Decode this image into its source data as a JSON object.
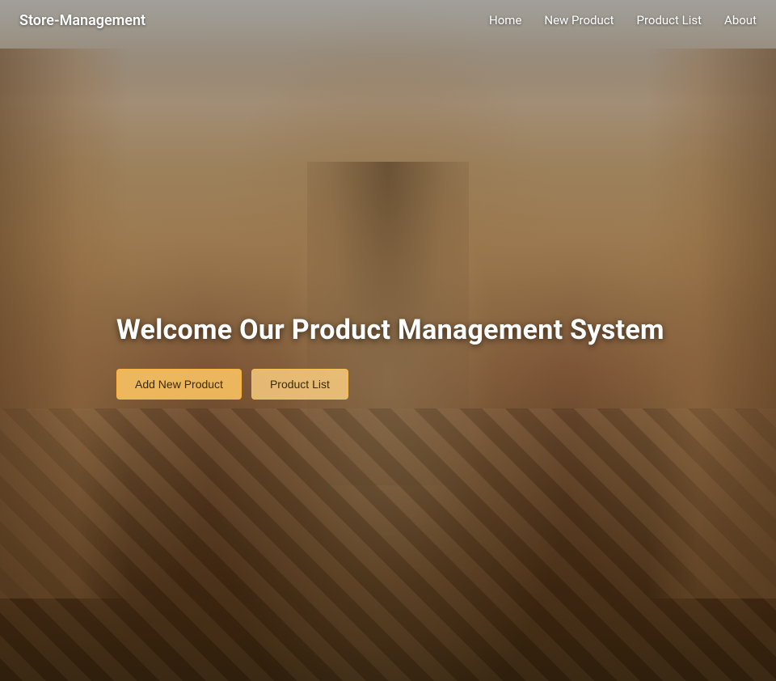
{
  "brand": {
    "name": "Store-Management"
  },
  "nav": {
    "links": [
      {
        "id": "home",
        "label": "Home"
      },
      {
        "id": "new-product",
        "label": "New Product"
      },
      {
        "id": "product-list",
        "label": "Product List"
      },
      {
        "id": "about",
        "label": "About"
      }
    ]
  },
  "hero": {
    "title": "Welcome Our Product Management System",
    "buttons": {
      "add_product": "Add New Product",
      "product_list": "Product List"
    }
  },
  "colors": {
    "nav_text": "#ffffff",
    "btn_bg": "rgba(255,200,100,0.85)",
    "btn_border": "rgba(255,180,60,0.9)",
    "btn_text": "#3a2a0a"
  }
}
